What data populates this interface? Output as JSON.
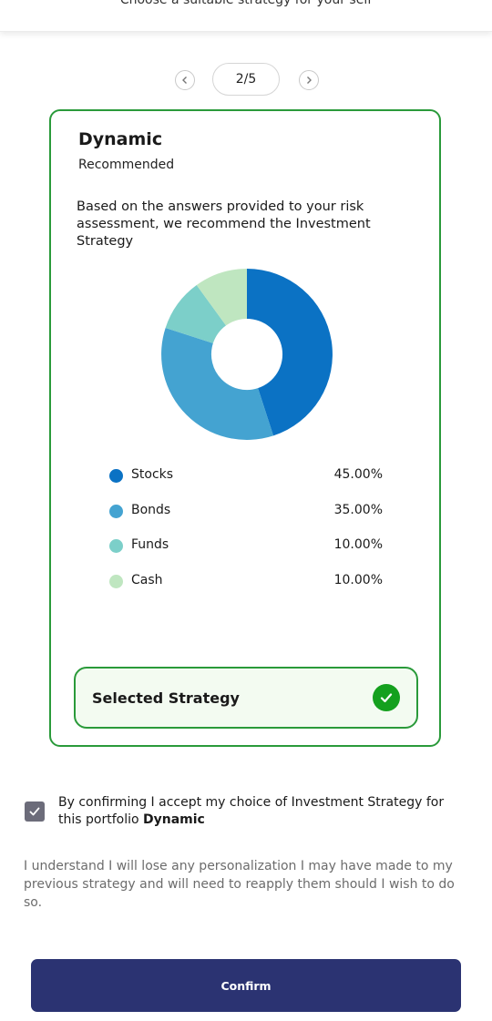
{
  "header": {
    "subtitle": "Choose a suitable strategy for your self"
  },
  "pager": {
    "current": "2/5",
    "prev_icon": "chevron-left-icon",
    "next_icon": "chevron-right-icon"
  },
  "strategy_card": {
    "title": "Dynamic",
    "subtitle": "Recommended",
    "description": "Based on the answers provided to your risk assessment, we recommend the Investment Strategy",
    "allocation": [
      {
        "label": "Stocks",
        "value": "45.00%",
        "percent": 45,
        "color": "#0b72c4"
      },
      {
        "label": "Bonds",
        "value": "35.00%",
        "percent": 35,
        "color": "#44a3d1"
      },
      {
        "label": "Funds",
        "value": "10.00%",
        "percent": 10,
        "color": "#7ccfc9"
      },
      {
        "label": "Cash",
        "value": "10.00%",
        "percent": 10,
        "color": "#bfe6c0"
      }
    ],
    "selected_label": "Selected Strategy",
    "selected_icon": "check-circle-icon",
    "accent_color": "#2a9a3a"
  },
  "consent": {
    "checked": true,
    "text_prefix": "By confirming I accept my choice of Investment Strategy for this portfolio ",
    "strategy_name": "Dynamic"
  },
  "note": "I understand I will lose any personalization I may have made to my previous strategy and will need to reapply them should I wish to do so.",
  "confirm_button": {
    "label": "Confirm",
    "color": "#2b3372"
  }
}
